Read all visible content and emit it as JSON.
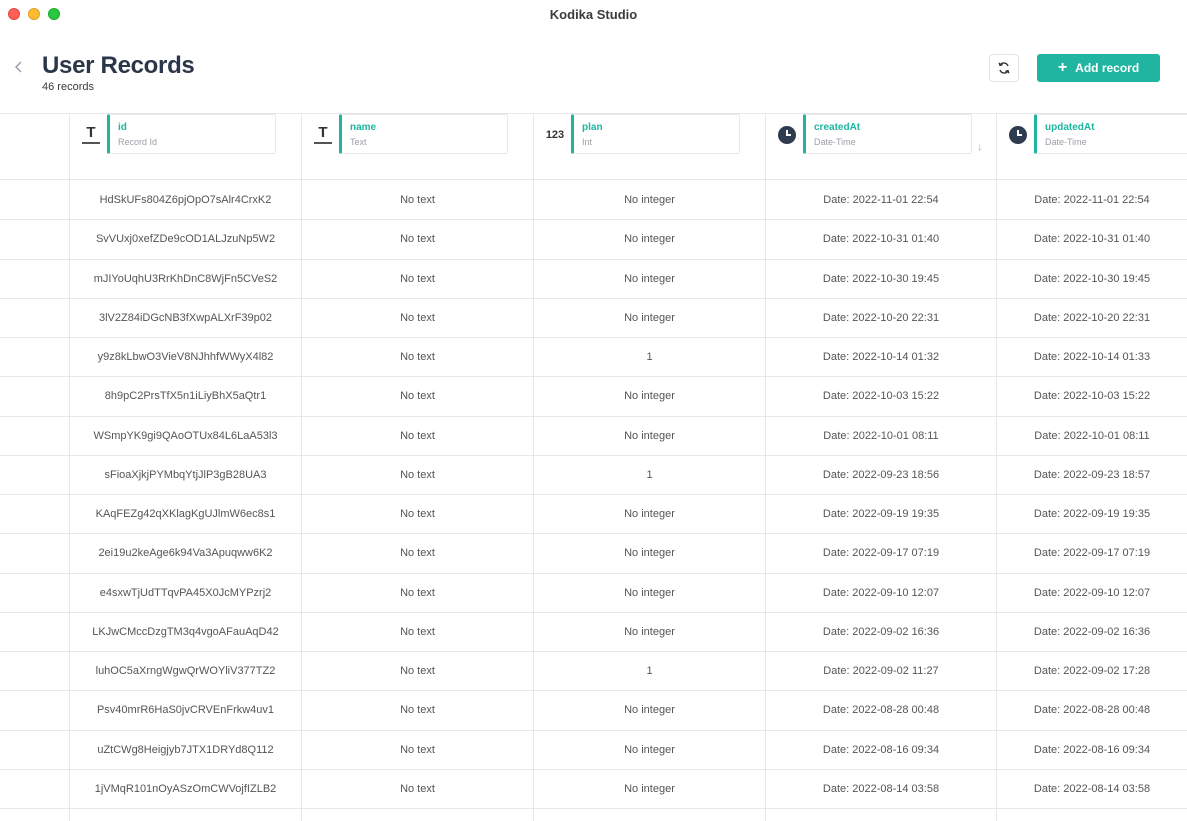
{
  "window": {
    "title": "Kodika Studio"
  },
  "header": {
    "back_icon": "chevron-left-icon",
    "title": "User Records",
    "count": "46 records",
    "refresh_icon": "refresh-icon",
    "add_label": "Add record",
    "add_icon": "+"
  },
  "colors": {
    "accent": "#1fb5a1",
    "title": "#2b3648"
  },
  "columns": [
    {
      "name": "id",
      "type": "Record Id",
      "icon": "T"
    },
    {
      "name": "name",
      "type": "Text",
      "icon": "T"
    },
    {
      "name": "plan",
      "type": "Int",
      "icon": "123"
    },
    {
      "name": "createdAt",
      "type": "Date-Time",
      "icon": "clock-icon",
      "sort": "↓"
    },
    {
      "name": "updatedAt",
      "type": "Date-Time",
      "icon": "clock-icon"
    }
  ],
  "rows": [
    {
      "id": "HdSkUFs804Z6pjOpO7sAlr4CrxK2",
      "name": "No text",
      "plan": "No integer",
      "created": "Date: 2022-11-01 22:54",
      "updated": "Date: 2022-11-01 22:54"
    },
    {
      "id": "SvVUxj0xefZDe9cOD1ALJzuNp5W2",
      "name": "No text",
      "plan": "No integer",
      "created": "Date: 2022-10-31 01:40",
      "updated": "Date: 2022-10-31 01:40"
    },
    {
      "id": "mJIYoUqhU3RrKhDnC8WjFn5CVeS2",
      "name": "No text",
      "plan": "No integer",
      "created": "Date: 2022-10-30 19:45",
      "updated": "Date: 2022-10-30 19:45"
    },
    {
      "id": "3lV2Z84iDGcNB3fXwpALXrF39p02",
      "name": "No text",
      "plan": "No integer",
      "created": "Date: 2022-10-20 22:31",
      "updated": "Date: 2022-10-20 22:31"
    },
    {
      "id": "y9z8kLbwO3VieV8NJhhfWWyX4l82",
      "name": "No text",
      "plan": "1",
      "created": "Date: 2022-10-14 01:32",
      "updated": "Date: 2022-10-14 01:33"
    },
    {
      "id": "8h9pC2PrsTfX5n1iLiyBhX5aQtr1",
      "name": "No text",
      "plan": "No integer",
      "created": "Date: 2022-10-03 15:22",
      "updated": "Date: 2022-10-03 15:22"
    },
    {
      "id": "WSmpYK9gi9QAoOTUx84L6LaA53l3",
      "name": "No text",
      "plan": "No integer",
      "created": "Date: 2022-10-01 08:11",
      "updated": "Date: 2022-10-01 08:11"
    },
    {
      "id": "sFioaXjkjPYMbqYtjJlP3gB28UA3",
      "name": "No text",
      "plan": "1",
      "created": "Date: 2022-09-23 18:56",
      "updated": "Date: 2022-09-23 18:57"
    },
    {
      "id": "KAqFEZg42qXKlagKgUJlmW6ec8s1",
      "name": "No text",
      "plan": "No integer",
      "created": "Date: 2022-09-19 19:35",
      "updated": "Date: 2022-09-19 19:35"
    },
    {
      "id": "2ei19u2keAge6k94Va3Apuqww6K2",
      "name": "No text",
      "plan": "No integer",
      "created": "Date: 2022-09-17 07:19",
      "updated": "Date: 2022-09-17 07:19"
    },
    {
      "id": "e4sxwTjUdTTqvPA45X0JcMYPzrj2",
      "name": "No text",
      "plan": "No integer",
      "created": "Date: 2022-09-10 12:07",
      "updated": "Date: 2022-09-10 12:07"
    },
    {
      "id": "LKJwCMccDzgTM3q4vgoAFauAqD42",
      "name": "No text",
      "plan": "No integer",
      "created": "Date: 2022-09-02 16:36",
      "updated": "Date: 2022-09-02 16:36"
    },
    {
      "id": "luhOC5aXrngWgwQrWOYliV377TZ2",
      "name": "No text",
      "plan": "1",
      "created": "Date: 2022-09-02 11:27",
      "updated": "Date: 2022-09-02 17:28"
    },
    {
      "id": "Psv40mrR6HaS0jvCRVEnFrkw4uv1",
      "name": "No text",
      "plan": "No integer",
      "created": "Date: 2022-08-28 00:48",
      "updated": "Date: 2022-08-28 00:48"
    },
    {
      "id": "uZtCWg8Heigjyb7JTX1DRYd8Q112",
      "name": "No text",
      "plan": "No integer",
      "created": "Date: 2022-08-16 09:34",
      "updated": "Date: 2022-08-16 09:34"
    },
    {
      "id": "1jVMqR101nOyASzOmCWVojfIZLB2",
      "name": "No text",
      "plan": "No integer",
      "created": "Date: 2022-08-14 03:58",
      "updated": "Date: 2022-08-14 03:58"
    }
  ]
}
